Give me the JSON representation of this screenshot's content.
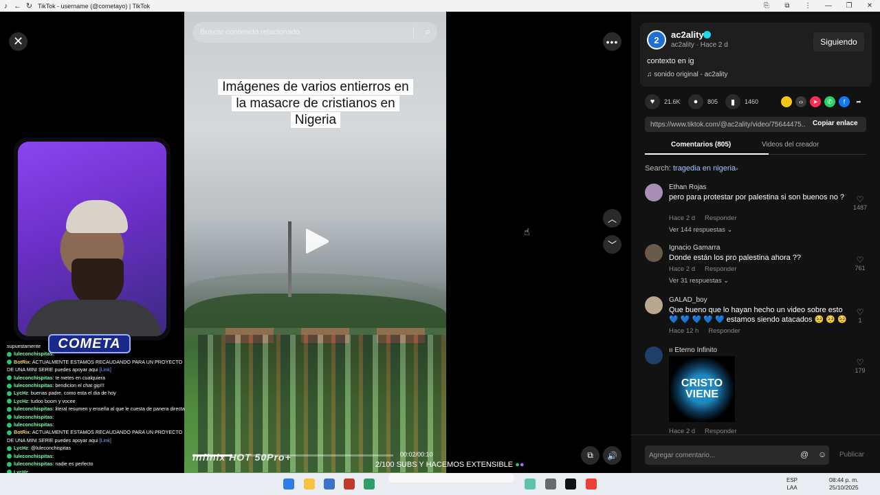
{
  "window": {
    "title": "TikTok - username (@cometayo) | TikTok"
  },
  "video": {
    "search_placeholder": "Buscar contenido relacionado",
    "caption": "Imágenes de varios entierros en la masacre de cristianos en Nigeria",
    "watermark": "Infinix HOT 50Pro+",
    "time": "00:02/00:10",
    "progress": 0.2
  },
  "stream": {
    "logo": "COMETA",
    "banner": "2/100 SUBS Y HACEMOS EXTENSIBLE",
    "chat": [
      {
        "user": "",
        "text": "supuestamente"
      },
      {
        "user": "luleconchispitas",
        "text": ":"
      },
      {
        "user": "BotRix",
        "text": ": ACTUALMENTE ESTAMOS RECAUDANDO PARA UN PROYECTO DE UNA MINI SERIE puedes apoyar aqui ",
        "link": "[Link]"
      },
      {
        "user": "luleconchispitas",
        "text": ": te metes en cualquiera"
      },
      {
        "user": "luleconchispitas",
        "text": ": bendicion el chat gip!!!"
      },
      {
        "user": "LycHz",
        "text": ": buenas padre, como esta el dia de hoy"
      },
      {
        "user": "LycHz",
        "text": ": tudoo boom y vocee"
      },
      {
        "user": "luleconchispitas",
        "text": ": literal resumen y enseña al que le cuesta de panera directa"
      },
      {
        "user": "luleconchispitas",
        "text": ":"
      },
      {
        "user": "luleconchispitas",
        "text": ":"
      },
      {
        "user": "BotRix",
        "text": ": ACTUALMENTE ESTAMOS RECAUDANDO PARA UN PROYECTO DE UNA MINI SERIE puedes apoyar aqui ",
        "link": "[Link]"
      },
      {
        "user": "LycHz",
        "text": ": @luleconchispitas"
      },
      {
        "user": "luleconchispitas",
        "text": ":"
      },
      {
        "user": "luleconchispitas",
        "text": ": nadie es perfecto"
      },
      {
        "user": "LycHz",
        "text": ":"
      }
    ]
  },
  "author": {
    "avatar_letter": "2",
    "name": "ac2ality",
    "sub": "ac2ality · Hace 2 d",
    "follow_label": "Siguiendo",
    "description": "contexto en ig",
    "sound": "sonido original - ac2ality"
  },
  "stats": {
    "likes": "21.6K",
    "comments": "805",
    "saves": "1460"
  },
  "share_colors": [
    "#f5c518",
    "#3a3a3a",
    "#fe2c55",
    "#25d366",
    "#1877f2"
  ],
  "link": {
    "url": "https://www.tiktok.com/@ac2ality/video/75644475...",
    "copy_label": "Copiar enlace"
  },
  "tabs": {
    "comments": "Comentarios (805)",
    "videos": "Videos del creador"
  },
  "search": {
    "prefix": "Search: ",
    "query": "tragedia en nigeria"
  },
  "comments": [
    {
      "name": "Ethan Rojas",
      "text": "pero para protestar por palestina si son buenos no ?",
      "meta": "Hace 2 d",
      "reply": "Responder",
      "replies": "Ver 144 respuestas",
      "likes": "1487",
      "color": "#a98fb8"
    },
    {
      "name": "Ignacio Gamarra",
      "text": "Donde están los pro palestina ahora ??",
      "meta": "Hace 2 d",
      "reply": "Responder",
      "replies": "Ver 31 respuestas",
      "likes": "761",
      "color": "#6a5a4a"
    },
    {
      "name": "GALAD_boy",
      "text": "Que bueno que lo hayan hecho un video sobre esto 💙 💙 💙 💙 💙 estamos siendo atacados 🥺 🥺 🥺",
      "meta": "Hace 12 h",
      "reply": "Responder",
      "replies": "",
      "likes": "1",
      "color": "#b8a890"
    },
    {
      "name": "ıı Eterno Infinito",
      "text": "",
      "meta": "Hace 2 d",
      "reply": "Responder",
      "replies": "",
      "likes": "179",
      "color": "#1d3f6a",
      "sticker": "CRISTO VIENE"
    }
  ],
  "comment_box": {
    "placeholder": "Agregar comentario...",
    "post_label": "Publicar"
  },
  "taskbar": {
    "lang": "ESP\nLAA",
    "time": "08:44 p. m.",
    "date": "25/10/2025"
  }
}
